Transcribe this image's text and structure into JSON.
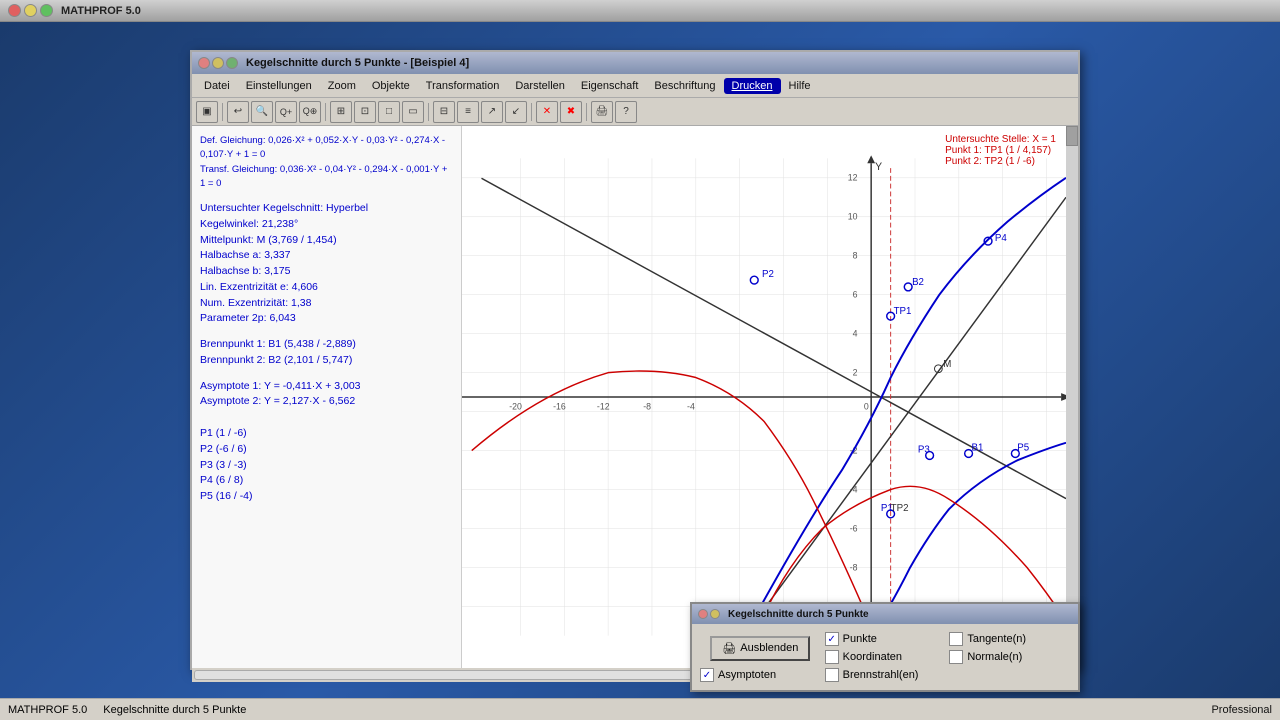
{
  "app": {
    "title": "MATHPROF 5.0",
    "window_title": "Kegelschnitte durch 5 Punkte - [Beispiel 4]",
    "status_left1": "MATHPROF 5.0",
    "status_left2": "Kegelschnitte durch 5 Punkte",
    "status_right": "Professional"
  },
  "menu": {
    "items": [
      {
        "label": "Datei",
        "active": false
      },
      {
        "label": "Einstellungen",
        "active": false
      },
      {
        "label": "Zoom",
        "active": false
      },
      {
        "label": "Objekte",
        "active": false
      },
      {
        "label": "Transformation",
        "active": false
      },
      {
        "label": "Darstellen",
        "active": false
      },
      {
        "label": "Eigenschaft",
        "active": false
      },
      {
        "label": "Beschriftung",
        "active": false
      },
      {
        "label": "Drucken",
        "active": true
      },
      {
        "label": "Hilfe",
        "active": false
      }
    ]
  },
  "info": {
    "line1": "Def. Gleichung: 0,026·X² + 0,052·X·Y - 0,03·Y² - 0,274·X - 0,107·Y + 1 = 0",
    "line2": "Transf. Gleichung: 0,036·X² - 0,04·Y² - 0,294·X - 0,001·Y + 1 = 0",
    "line3": "Untersuchter Kegelschnitt: Hyperbel",
    "line4": "Kegelwinkel: 21,238°",
    "line5": "Mittelpunkt: M (3,769 / 1,454)",
    "line6": "Halbachse a: 3,337",
    "line7": "Halbachse b: 3,175",
    "line8": "Lin. Exzentrizität e: 4,606",
    "line9": "Num. Exzentrizität: 1,38",
    "line10": "Parameter 2p: 6,043",
    "line11": "Brennpunkt 1: B1 (5,438 / -2,889)",
    "line12": "Brennpunkt 2: B2 (2,101 / 5,747)",
    "line13": "Asymptote 1: Y = -0,411·X + 3,003",
    "line14": "Asymptote 2: Y = 2,127·X - 6,562",
    "line15": "P1 (1 / -6)",
    "line16": "P2 (-6 / 6)",
    "line17": "P3 (3 / -3)",
    "line18": "P4 (6 / 8)",
    "line19": "P5 (16 / -4)"
  },
  "right_info": {
    "line1": "Untersuchte Stelle: X = 1",
    "line2": "Punkt 1: TP1 (1 / 4,157)",
    "line3": "Punkt 2: TP2 (1 / -6)"
  },
  "popup": {
    "title": "Kegelschnitte durch 5 Punkte",
    "checkboxes": [
      {
        "label": "Punkte",
        "checked": true
      },
      {
        "label": "Tangente(n)",
        "checked": false
      },
      {
        "label": "Koordinaten",
        "checked": false
      },
      {
        "label": "Normale(n)",
        "checked": false
      },
      {
        "label": "Asymptoten",
        "checked": true
      },
      {
        "label": "Brennstrahl(en)",
        "checked": false
      }
    ],
    "button": "Ausblenden"
  }
}
